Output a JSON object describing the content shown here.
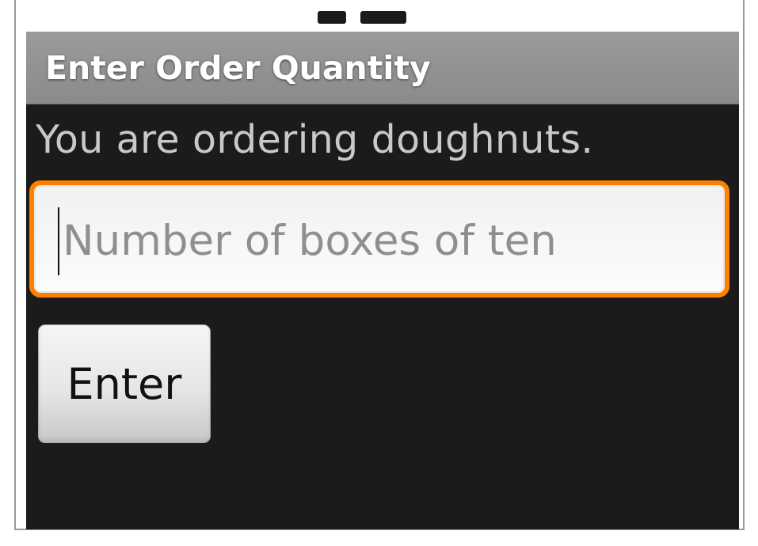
{
  "title_bar": {
    "title": "Enter Order Quantity"
  },
  "main": {
    "message": "You are ordering doughnuts.",
    "quantity_input": {
      "value": "",
      "placeholder": "Number of boxes of ten"
    },
    "enter_button": {
      "label": "Enter"
    }
  },
  "colors": {
    "focus_border": "#ff7f00",
    "background": "#1b1b1b",
    "title_bar": "#959595"
  }
}
